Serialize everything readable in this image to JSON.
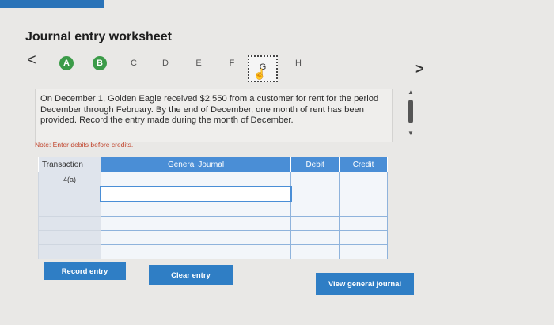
{
  "header": {
    "title": "Journal entry worksheet"
  },
  "nav": {
    "prev_glyph": "<",
    "next_glyph": ">",
    "steps": [
      {
        "label": "A",
        "state": "done"
      },
      {
        "label": "B",
        "state": "done"
      },
      {
        "label": "C",
        "state": "plain"
      },
      {
        "label": "D",
        "state": "plain"
      },
      {
        "label": "E",
        "state": "plain"
      },
      {
        "label": "F",
        "state": "plain"
      },
      {
        "label": "G",
        "state": "current"
      },
      {
        "label": "H",
        "state": "plain"
      }
    ]
  },
  "scenario": {
    "text": "On December 1, Golden Eagle received $2,550 from a customer for rent for the period December through February. By the end of December, one month of rent has been provided. Record the entry made during the month of December."
  },
  "note": "Note: Enter debits before credits.",
  "table": {
    "headers": {
      "transaction": "Transaction",
      "journal": "General Journal",
      "debit": "Debit",
      "credit": "Credit"
    },
    "transaction_value": "4(a)",
    "row_count": 6
  },
  "buttons": {
    "record": "Record entry",
    "clear": "Clear entry",
    "view": "View general journal"
  },
  "colors": {
    "accent": "#2f7ec5",
    "step_done": "#3b9b48",
    "table_header": "#4a8ed6",
    "note": "#c2452d"
  }
}
